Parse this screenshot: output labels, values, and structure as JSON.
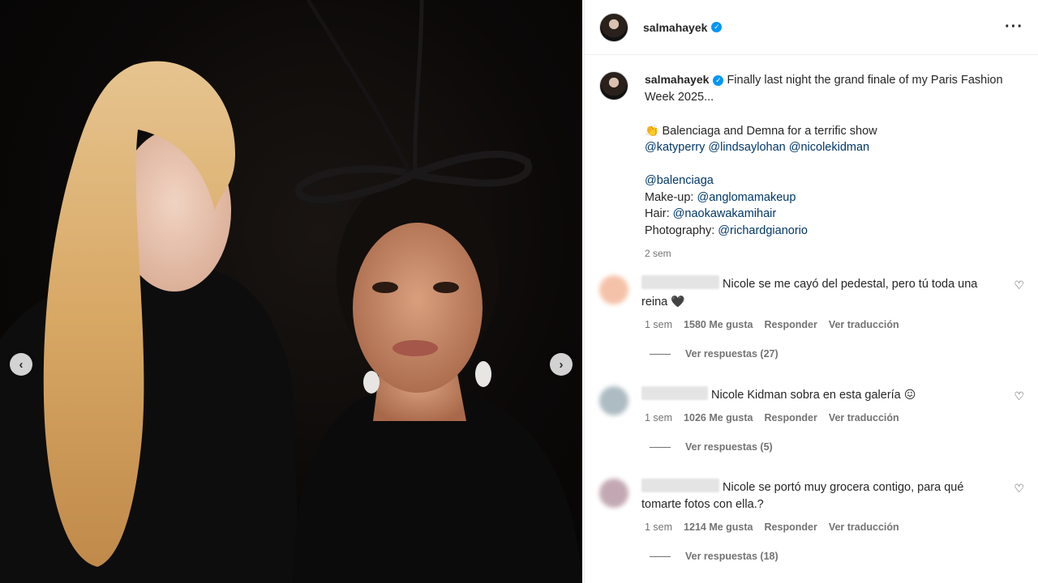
{
  "post": {
    "username": "salmahayek",
    "verified_glyph": "✓",
    "more_icon": "more-horizontal-icon"
  },
  "media": {
    "prev_glyph": "‹",
    "next_glyph": "›"
  },
  "caption": {
    "username": "salmahayek",
    "line1": "Finally last night the grand finale of my Paris Fashion Week 2025...",
    "clap": "👏",
    "line2": "Balenciaga and Demna for a terrific show",
    "mentions1": [
      "@katyperry",
      "@lindsaylohan",
      "@nicolekidman"
    ],
    "mention_balenciaga": "@balenciaga",
    "makeup_label": "Make-up:",
    "makeup_mention": "@anglomamakeup",
    "hair_label": "Hair:",
    "hair_mention": "@naokawakamihair",
    "photo_label": "Photography:",
    "photo_mention": "@richardgianorio",
    "time": "2 sem"
  },
  "comments": [
    {
      "text": "Nicole se me cayó del pedestal, pero tú toda una reina",
      "emoji": "🖤",
      "time": "1 sem",
      "likes": "1580 Me gusta",
      "reply": "Responder",
      "translate": "Ver traducción",
      "replies": "Ver respuestas (27)",
      "avatar_color": "#f3b89a"
    },
    {
      "text": "Nicole Kidman sobra en esta galería",
      "emoji": "😖",
      "time": "1 sem",
      "likes": "1026 Me gusta",
      "reply": "Responder",
      "translate": "Ver traducción",
      "replies": "Ver respuestas (5)",
      "avatar_color": "#9fb0b8"
    },
    {
      "text": "Nicole se portó muy grocera contigo, para qué tomarte fotos con ella.?",
      "emoji": "",
      "time": "1 sem",
      "likes": "1214 Me gusta",
      "reply": "Responder",
      "translate": "Ver traducción",
      "replies": "Ver respuestas (18)",
      "avatar_color": "#b99aa6"
    }
  ],
  "icons": {
    "heart": "♡"
  }
}
